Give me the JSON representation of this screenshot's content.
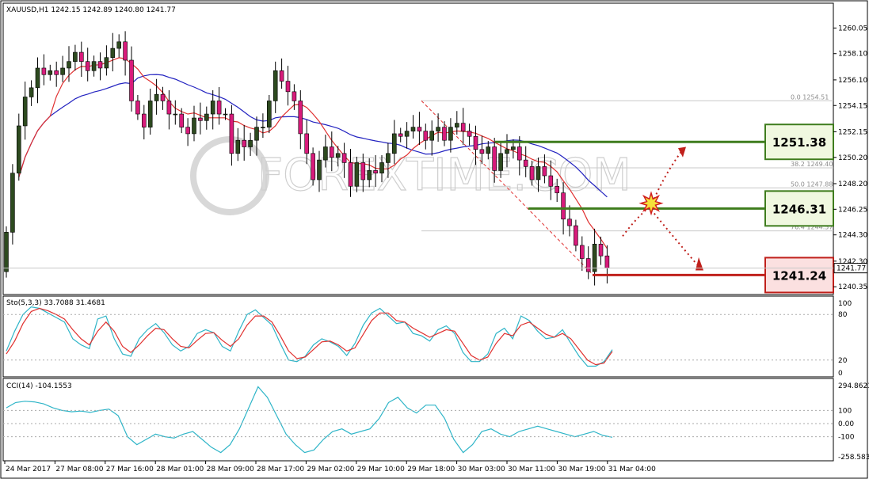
{
  "window": {
    "symbol_line": "XAUUSD,H1  1242.15 1242.89 1240.80 1241.77",
    "watermark": "FOREXTIME.COM"
  },
  "chart_data": [
    {
      "type": "candlestick",
      "title": "XAUUSD,H1  1242.15 1242.89 1240.80 1241.77",
      "ylim": [
        1240.0,
        1261.7
      ],
      "yticks": [
        {
          "value": 1260.05,
          "label": "1260.05"
        },
        {
          "value": 1258.1,
          "label": "1258.10"
        },
        {
          "value": 1256.1,
          "label": "1256.10"
        },
        {
          "value": 1254.15,
          "label": "1254.15"
        },
        {
          "value": 1252.15,
          "label": "1252.15"
        },
        {
          "value": 1250.2,
          "label": "1250.20"
        },
        {
          "value": 1248.2,
          "label": "1248.20"
        },
        {
          "value": 1246.25,
          "label": "1246.25"
        },
        {
          "value": 1244.3,
          "label": "1244.30"
        },
        {
          "value": 1242.3,
          "label": "1242.30"
        },
        {
          "value": 1240.35,
          "label": "1240.35"
        }
      ],
      "current_price": {
        "value": 1241.77,
        "label": "1241.77"
      },
      "x_labels": [
        "24 Mar 2017",
        "27 Mar 08:00",
        "27 Mar 16:00",
        "28 Mar 01:00",
        "28 Mar 09:00",
        "28 Mar 17:00",
        "29 Mar 02:00",
        "29 Mar 10:00",
        "29 Mar 18:00",
        "30 Mar 03:00",
        "30 Mar 11:00",
        "30 Mar 19:00",
        "31 Mar 04:00"
      ],
      "bull_color": "#2d4a1f",
      "bear_color": "#d81b7b",
      "closes": [
        1244.5,
        1249,
        1252.6,
        1254.8,
        1255.5,
        1257,
        1256.5,
        1256.8,
        1256.5,
        1257,
        1257.5,
        1258.2,
        1257.5,
        1256.8,
        1257.5,
        1257,
        1257.8,
        1258.5,
        1259,
        1257.6,
        1254.5,
        1253.5,
        1252.5,
        1254.5,
        1255,
        1254.5,
        1253.5,
        1253.5,
        1252.5,
        1252,
        1253.2,
        1253,
        1253.5,
        1254.5,
        1253.5,
        1253.5,
        1250.5,
        1251.5,
        1251,
        1251.5,
        1252.5,
        1252.5,
        1254.5,
        1256.8,
        1256,
        1255.2,
        1254.5,
        1252,
        1250.5,
        1248.5,
        1250,
        1251,
        1250.2,
        1250.5,
        1249.8,
        1248,
        1249.8,
        1248.5,
        1249.2,
        1249,
        1249.8,
        1250.5,
        1252,
        1251.8,
        1252.2,
        1252.5,
        1252.2,
        1251.5,
        1252.2,
        1252.5,
        1251.5,
        1252.5,
        1252.8,
        1252.2,
        1251.8,
        1250.8,
        1250.5,
        1251,
        1249.2,
        1250.5,
        1250.8,
        1251,
        1250,
        1249.5,
        1248.5,
        1249.5,
        1248.8,
        1248,
        1247.5,
        1245.5,
        1245,
        1243.5,
        1242.5,
        1241.5,
        1243.6,
        1242.7,
        1241.77
      ],
      "sma_fast_color": "#e03030",
      "sma_slow_color": "#2222c0",
      "fibonacci": [
        {
          "value": 1254.51,
          "label": "0.0  1254.51"
        },
        {
          "value": 1249.4,
          "label": "38.2  1249.40"
        },
        {
          "value": 1247.88,
          "label": "50.0  1247.88"
        },
        {
          "value": 1244.6,
          "label": "76.4  1244.57"
        }
      ],
      "annotations": [
        {
          "label": "1251.38",
          "value": 1251.38,
          "color": "#3f7d1e",
          "fill": "#f0f8e0"
        },
        {
          "label": "1246.31",
          "value": 1246.31,
          "color": "#3f7d1e",
          "fill": "#f0f8e0"
        },
        {
          "label": "1241.24",
          "value": 1241.24,
          "color": "#c0201b",
          "fill": "#fbe0e0"
        }
      ]
    },
    {
      "type": "line",
      "title": "Sto(5,3,3) 33.7088 31.4681",
      "ylim": [
        0,
        100
      ],
      "yticks": [
        {
          "value": 100,
          "label": "100"
        },
        {
          "value": 80,
          "label": "80"
        },
        {
          "value": 20,
          "label": "20"
        },
        {
          "value": 0,
          "label": "0"
        }
      ],
      "series": [
        {
          "color": "#2fb5c8",
          "values": [
            32,
            58,
            80,
            90,
            88,
            82,
            76,
            70,
            48,
            40,
            35,
            74,
            78,
            48,
            28,
            25,
            48,
            60,
            68,
            56,
            40,
            32,
            38,
            55,
            60,
            56,
            38,
            32,
            58,
            80,
            86,
            76,
            66,
            42,
            20,
            18,
            25,
            40,
            48,
            44,
            38,
            26,
            42,
            66,
            82,
            88,
            78,
            68,
            70,
            55,
            52,
            45,
            60,
            65,
            55,
            30,
            18,
            18,
            28,
            55,
            62,
            48,
            78,
            72,
            58,
            48,
            50,
            60,
            42,
            25,
            12,
            12,
            18,
            33.7
          ]
        },
        {
          "color": "#e0302e",
          "values": [
            28,
            45,
            68,
            84,
            88,
            85,
            80,
            74,
            60,
            48,
            40,
            58,
            70,
            58,
            38,
            30,
            40,
            52,
            62,
            60,
            48,
            38,
            36,
            46,
            55,
            56,
            46,
            38,
            48,
            66,
            78,
            78,
            70,
            52,
            32,
            22,
            24,
            34,
            44,
            45,
            40,
            32,
            36,
            54,
            72,
            82,
            82,
            72,
            70,
            62,
            56,
            50,
            55,
            60,
            58,
            42,
            26,
            20,
            24,
            42,
            55,
            52,
            66,
            70,
            62,
            54,
            50,
            55,
            48,
            34,
            20,
            14,
            16,
            31.5
          ]
        }
      ]
    },
    {
      "type": "line",
      "title": "CCI(14) -104.1553",
      "ylim": [
        -258.5831,
        294.8623
      ],
      "yticks": [
        {
          "value": 294.8623,
          "label": "294.8623"
        },
        {
          "value": 100,
          "label": "100"
        },
        {
          "value": 0,
          "label": "0.00"
        },
        {
          "value": -100,
          "label": "-100"
        },
        {
          "value": -258.5831,
          "label": "-258.5831"
        }
      ],
      "series": [
        {
          "color": "#2fb5c8",
          "values": [
            120,
            160,
            170,
            165,
            150,
            120,
            100,
            90,
            95,
            85,
            100,
            110,
            60,
            -100,
            -160,
            -120,
            -80,
            -100,
            -110,
            -80,
            -60,
            -120,
            -180,
            -220,
            -160,
            -40,
            120,
            280,
            200,
            60,
            -80,
            -160,
            -220,
            -200,
            -120,
            -60,
            -40,
            -80,
            -60,
            -40,
            40,
            160,
            200,
            120,
            80,
            140,
            140,
            40,
            -120,
            -220,
            -160,
            -60,
            -40,
            -80,
            -100,
            -60,
            -40,
            -20,
            -40,
            -60,
            -80,
            -100,
            -80,
            -60,
            -90,
            -104
          ]
        }
      ]
    }
  ]
}
